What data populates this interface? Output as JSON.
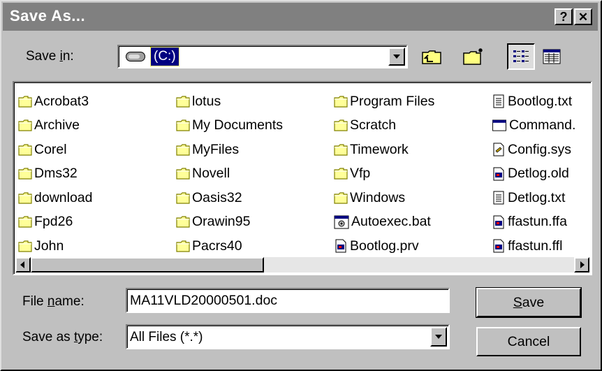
{
  "dialog": {
    "title": "Save As...",
    "help_button": "?",
    "close_button": "✕"
  },
  "save_in": {
    "label_pre": "Save ",
    "label_accel": "i",
    "label_post": "n:",
    "value": "(C:)"
  },
  "files": {
    "columns": [
      [
        {
          "name": "Acrobat3",
          "icon": "folder-icon"
        },
        {
          "name": "Archive",
          "icon": "folder-icon"
        },
        {
          "name": "Corel",
          "icon": "folder-icon"
        },
        {
          "name": "Dms32",
          "icon": "folder-icon"
        },
        {
          "name": "download",
          "icon": "folder-icon"
        },
        {
          "name": "Fpd26",
          "icon": "folder-icon"
        },
        {
          "name": "John",
          "icon": "folder-icon"
        }
      ],
      [
        {
          "name": "lotus",
          "icon": "folder-icon"
        },
        {
          "name": "My Documents",
          "icon": "folder-icon"
        },
        {
          "name": "MyFiles",
          "icon": "folder-icon"
        },
        {
          "name": "Novell",
          "icon": "folder-icon"
        },
        {
          "name": "Oasis32",
          "icon": "folder-icon"
        },
        {
          "name": "Orawin95",
          "icon": "folder-icon"
        },
        {
          "name": "Pacrs40",
          "icon": "folder-icon"
        }
      ],
      [
        {
          "name": "Program Files",
          "icon": "folder-icon"
        },
        {
          "name": "Scratch",
          "icon": "folder-icon"
        },
        {
          "name": "Timework",
          "icon": "folder-icon"
        },
        {
          "name": "Vfp",
          "icon": "folder-icon"
        },
        {
          "name": "Windows",
          "icon": "folder-icon"
        },
        {
          "name": "Autoexec.bat",
          "icon": "batch-file-icon"
        },
        {
          "name": "Bootlog.prv",
          "icon": "system-file-icon"
        }
      ],
      [
        {
          "name": "Bootlog.txt",
          "icon": "text-file-icon"
        },
        {
          "name": "Command.",
          "icon": "dos-window-icon"
        },
        {
          "name": "Config.sys",
          "icon": "config-file-icon"
        },
        {
          "name": "Detlog.old",
          "icon": "system-file-icon"
        },
        {
          "name": "Detlog.txt",
          "icon": "text-file-icon"
        },
        {
          "name": "ffastun.ffa",
          "icon": "system-file-icon"
        },
        {
          "name": "ffastun.ffl",
          "icon": "system-file-icon"
        }
      ]
    ]
  },
  "filename": {
    "label_pre": "File ",
    "label_accel": "n",
    "label_post": "ame:",
    "value": "MA11VLD20000501.doc"
  },
  "filetype": {
    "label_pre": "Save as ",
    "label_accel": "t",
    "label_post": "ype:",
    "value": "All Files (*.*)"
  },
  "buttons": {
    "save_accel": "S",
    "save_rest": "ave",
    "cancel": "Cancel"
  },
  "colors": {
    "titlebar": "#808080",
    "face": "#c0c0c0",
    "folder": "#ffff99",
    "selection": "#000080"
  }
}
